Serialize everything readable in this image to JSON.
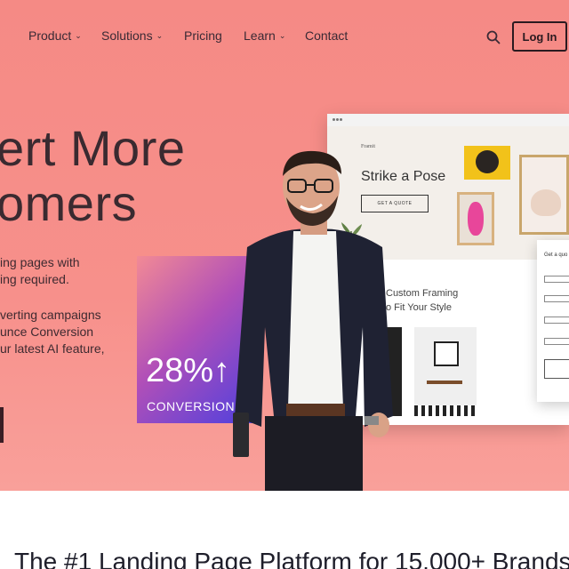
{
  "nav": {
    "items": [
      {
        "label": "Product",
        "has_caret": true
      },
      {
        "label": "Solutions",
        "has_caret": true
      },
      {
        "label": "Pricing",
        "has_caret": false
      },
      {
        "label": "Learn",
        "has_caret": true
      },
      {
        "label": "Contact",
        "has_caret": false
      }
    ],
    "caret": "⌄",
    "search_icon": "search-icon",
    "login_label": "Log In"
  },
  "hero": {
    "headline": "ert More\nomers",
    "subtext_1": "ing pages with\ning required.",
    "subtext_2": "verting campaigns\nunce Conversion\nur latest AI feature,",
    "background_color": "#f58a85"
  },
  "stat_card": {
    "value": "28%↑",
    "label": "CONVERSIONS"
  },
  "mockup": {
    "brand": "Framit",
    "heading": "Strike a Pose",
    "cta": "GET A QUOTE",
    "section_heading": "Custom Framing\no Fit Your Style",
    "form_title": "Get a quo"
  },
  "bottom": {
    "title": "The #1 Landing Page Platform for 15,000+ Brands"
  }
}
